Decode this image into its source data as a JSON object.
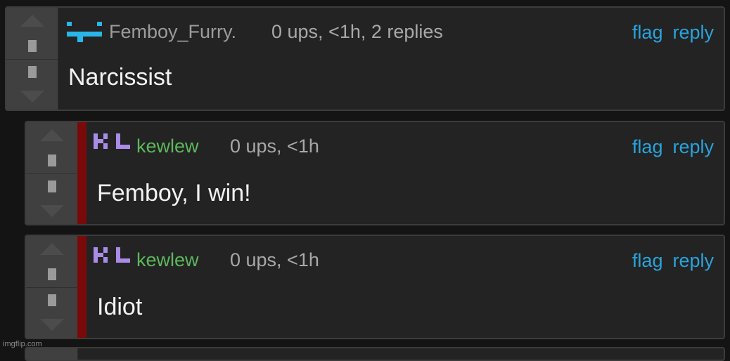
{
  "comments": [
    {
      "username": "Femboy_Furry.",
      "meta": "0 ups, <1h, 2 replies",
      "flag": "flag",
      "reply": "reply",
      "text": "Narcissist",
      "username_color": "#9c9c9c",
      "avatar_color": "#29b6e8"
    },
    {
      "username": "kewlew",
      "meta": "0 ups, <1h",
      "flag": "flag",
      "reply": "reply",
      "text": "Femboy, I win!",
      "username_color": "#5cb85c",
      "avatar_color": "#a98ce8"
    },
    {
      "username": "kewlew",
      "meta": "0 ups, <1h",
      "flag": "flag",
      "reply": "reply",
      "text": "Idiot",
      "username_color": "#5cb85c",
      "avatar_color": "#a98ce8"
    }
  ],
  "watermark": "imgflip.com",
  "colors": {
    "link": "#29a3dc",
    "reply_bar": "#7a0a0a",
    "panel": "#232323",
    "background": "#141414"
  },
  "icons": [
    "upvote-arrow-icon",
    "downvote-arrow-icon",
    "pixel-avatar-icon"
  ]
}
